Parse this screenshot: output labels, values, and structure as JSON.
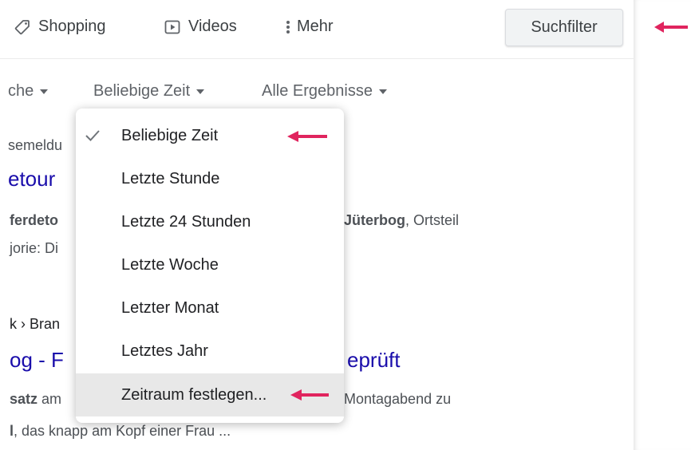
{
  "nav": {
    "shopping": "Shopping",
    "videos": "Videos",
    "more": "Mehr",
    "filter_button": "Suchfilter"
  },
  "filters": {
    "language_partial": "che",
    "time": "Beliebige Zeit",
    "results": "Alle Ergebnisse"
  },
  "results_bg": {
    "r1_snippet_partial": "semeldu",
    "r1_title_partial": "etour",
    "r1_line1_bold_left": "ferdeto",
    "r1_line1_bold_right": "Jüterbog",
    "r1_line1_tail": ", Ortsteil",
    "r1_line2": "jorie: Di",
    "r2_crumb": "k › Bran",
    "r2_title_left": "og - F",
    "r2_title_right": "eprüft",
    "r2_snip_bold": "satz",
    "r2_snip_am": " am",
    "r2_snip_right": "Montagabend zu",
    "r2_snip2_bold": "l",
    "r2_snip2_rest": ", das knapp am Kopf einer Frau ..."
  },
  "time_menu": {
    "items": [
      {
        "label": "Beliebige Zeit",
        "selected": true
      },
      {
        "label": "Letzte Stunde"
      },
      {
        "label": "Letzte 24 Stunden"
      },
      {
        "label": "Letzte Woche"
      },
      {
        "label": "Letzter Monat"
      },
      {
        "label": "Letztes Jahr"
      },
      {
        "label": "Zeitraum festlegen...",
        "hovered": true
      }
    ]
  },
  "colors": {
    "annotation_arrow": "#e0245e",
    "link": "#1a0dab"
  },
  "icons": {
    "shopping": "tag-icon",
    "videos": "play-box-icon",
    "more": "vertical-dots-icon",
    "selected": "checkmark-icon",
    "annotation": "left-arrow-icon"
  }
}
